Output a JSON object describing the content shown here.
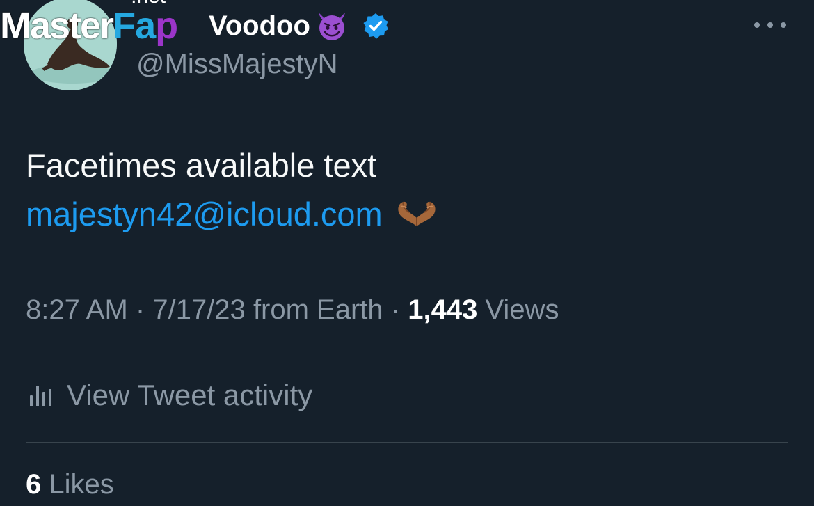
{
  "watermark": {
    "master": "Master",
    "fap_f": "Fa",
    "fap_p": "p",
    "net": ".net"
  },
  "author": {
    "display_name": "Voodoo",
    "name_emoji": "smiling-imp",
    "verified": true,
    "handle": "@MissMajestyN"
  },
  "tweet": {
    "text": "Facetimes available text",
    "link": "majestyn42@icloud.com",
    "trailing_emoji": "heart-hands"
  },
  "meta": {
    "time": "8:27 AM",
    "date": "7/17/23",
    "source": "from Earth",
    "views_count": "1,443",
    "views_label": "Views",
    "separator": "·"
  },
  "activity": {
    "label": "View Tweet activity"
  },
  "likes": {
    "count": "6",
    "label": "Likes"
  },
  "colors": {
    "background": "#15202b",
    "link": "#1d9bf0",
    "secondary_text": "#8b98a5",
    "primary_text": "#f7f9f9",
    "divider": "#38444d",
    "verified": "#1d9bf0"
  }
}
